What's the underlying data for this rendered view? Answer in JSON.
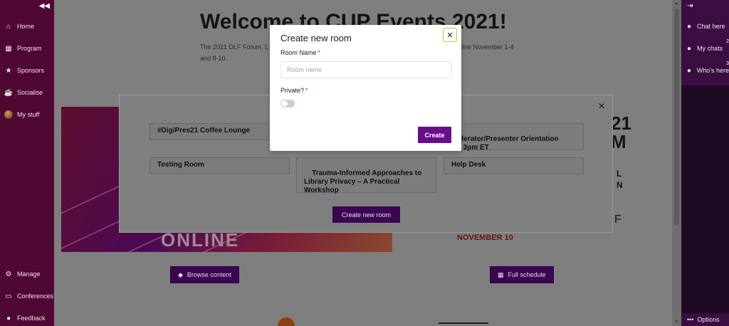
{
  "left_sidebar": {
    "items": [
      {
        "label": "Home",
        "icon": "home-icon"
      },
      {
        "label": "Program",
        "icon": "calendar-icon"
      },
      {
        "label": "Sponsors",
        "icon": "star-icon"
      },
      {
        "label": "Socialise",
        "icon": "coffee-icon"
      },
      {
        "label": "My stuff",
        "icon": "avatar"
      }
    ],
    "bottom_items": [
      {
        "label": "Manage",
        "icon": "gear-icon"
      },
      {
        "label": "Conferences",
        "icon": "keyboard-icon"
      },
      {
        "label": "Feedback",
        "icon": "comment-icon"
      }
    ]
  },
  "right_sidebar": {
    "items": [
      {
        "label": "Chat here",
        "icon": "chat-icon"
      },
      {
        "label": "My chats",
        "icon": "chats-icon",
        "badge": "2"
      },
      {
        "label": "Who's here",
        "icon": "users-icon",
        "badge": "3"
      }
    ],
    "options_label": "Options"
  },
  "page": {
    "title": "Welcome to CUP Events 2021!",
    "intro_start": "The 2021 DLF Forum, L",
    "intro_right": "nline November 1-4",
    "intro_tail": "and 8-10.",
    "banner_peek_1": "21\nM",
    "banner_peek_2": "L\nN",
    "banner_peek_3": "F",
    "banner_bottom_text": "ONLINE",
    "date_text": "NOVEMBER 10",
    "browse_label": "Browse content",
    "schedule_label": "Full schedule"
  },
  "rooms_modal": {
    "rooms": [
      "#DigiPres21 Coffee Lounge",
      "derator/Presenter Orientation\n/27 3pm ET",
      "Testing Room",
      "Trauma-Informed Approaches to\nLibrary Privacy – A Practical\nWorkshop",
      "Help Desk"
    ],
    "create_room_label": "Create new room"
  },
  "dialog": {
    "title": "Create new room",
    "room_name_label": "Room Name",
    "room_name_placeholder": "Room name",
    "room_name_value": "",
    "private_label": "Private?",
    "required_mark": "*",
    "private_enabled": false,
    "create_label": "Create"
  },
  "colors": {
    "accent_purple": "#6a0b8c",
    "sidebar_left": "#4f0831",
    "sidebar_right": "#1f0a24",
    "focus_ring": "#e5b52a",
    "required": "#cc1f2c"
  }
}
